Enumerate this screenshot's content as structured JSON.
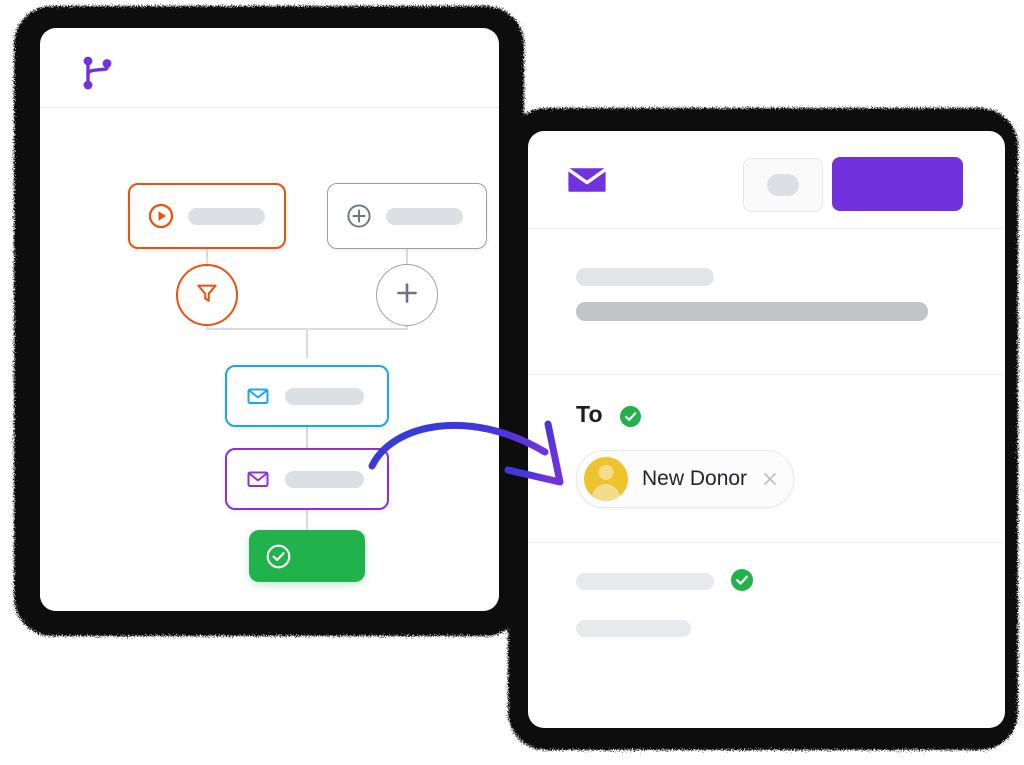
{
  "meta": {
    "scene": "two-overlapping-device-mockups",
    "accent_purple": "#7131dd",
    "accent_orange": "#e8530e",
    "accent_blue": "#19a8f0",
    "accent_violet": "#8b2fe0",
    "accent_green": "#22b24c",
    "avatar_yellow": "#eec32f",
    "frame_black": "#0d0d0d",
    "placeholder_gray": "#dcdfe4"
  },
  "workflow_panel": {
    "header": {
      "icon": "git-branch-icon"
    },
    "nodes": [
      {
        "id": "trigger",
        "icon": "play-circle-icon",
        "accent": "#e8530e",
        "label": ""
      },
      {
        "id": "action",
        "icon": "plus-circle-icon",
        "accent": "#9aa0a8",
        "label": ""
      },
      {
        "id": "filter",
        "icon": "filter-icon",
        "accent": "#e8530e",
        "shape": "circle"
      },
      {
        "id": "add",
        "icon": "plus-icon",
        "accent": "#9aa0a8",
        "shape": "circle"
      },
      {
        "id": "email-blue",
        "icon": "envelope-icon",
        "accent": "#19a8f0",
        "label": ""
      },
      {
        "id": "email-purple",
        "icon": "envelope-icon",
        "accent": "#8b2fe0",
        "label": ""
      },
      {
        "id": "end",
        "icon": "check-circle-icon",
        "accent": "#22b24c",
        "label": ""
      }
    ]
  },
  "arrow": {
    "name": "curved-connector-arrow",
    "gradient_from": "#2b3fd8",
    "gradient_to": "#7131dd"
  },
  "email_panel": {
    "header": {
      "icon": "envelope-filled-icon",
      "ghost_button_label": "",
      "primary_button_label": ""
    },
    "subject_section": {
      "line_one": "",
      "line_two": ""
    },
    "to_section": {
      "label": "To",
      "verified_icon": "check-badge-icon",
      "recipient": {
        "name": "New Donor",
        "avatar": "person-avatar",
        "remove_icon": "close-icon"
      }
    },
    "body_section": {
      "line_one": "",
      "line_one_status_icon": "check-badge-icon",
      "line_two": ""
    }
  }
}
